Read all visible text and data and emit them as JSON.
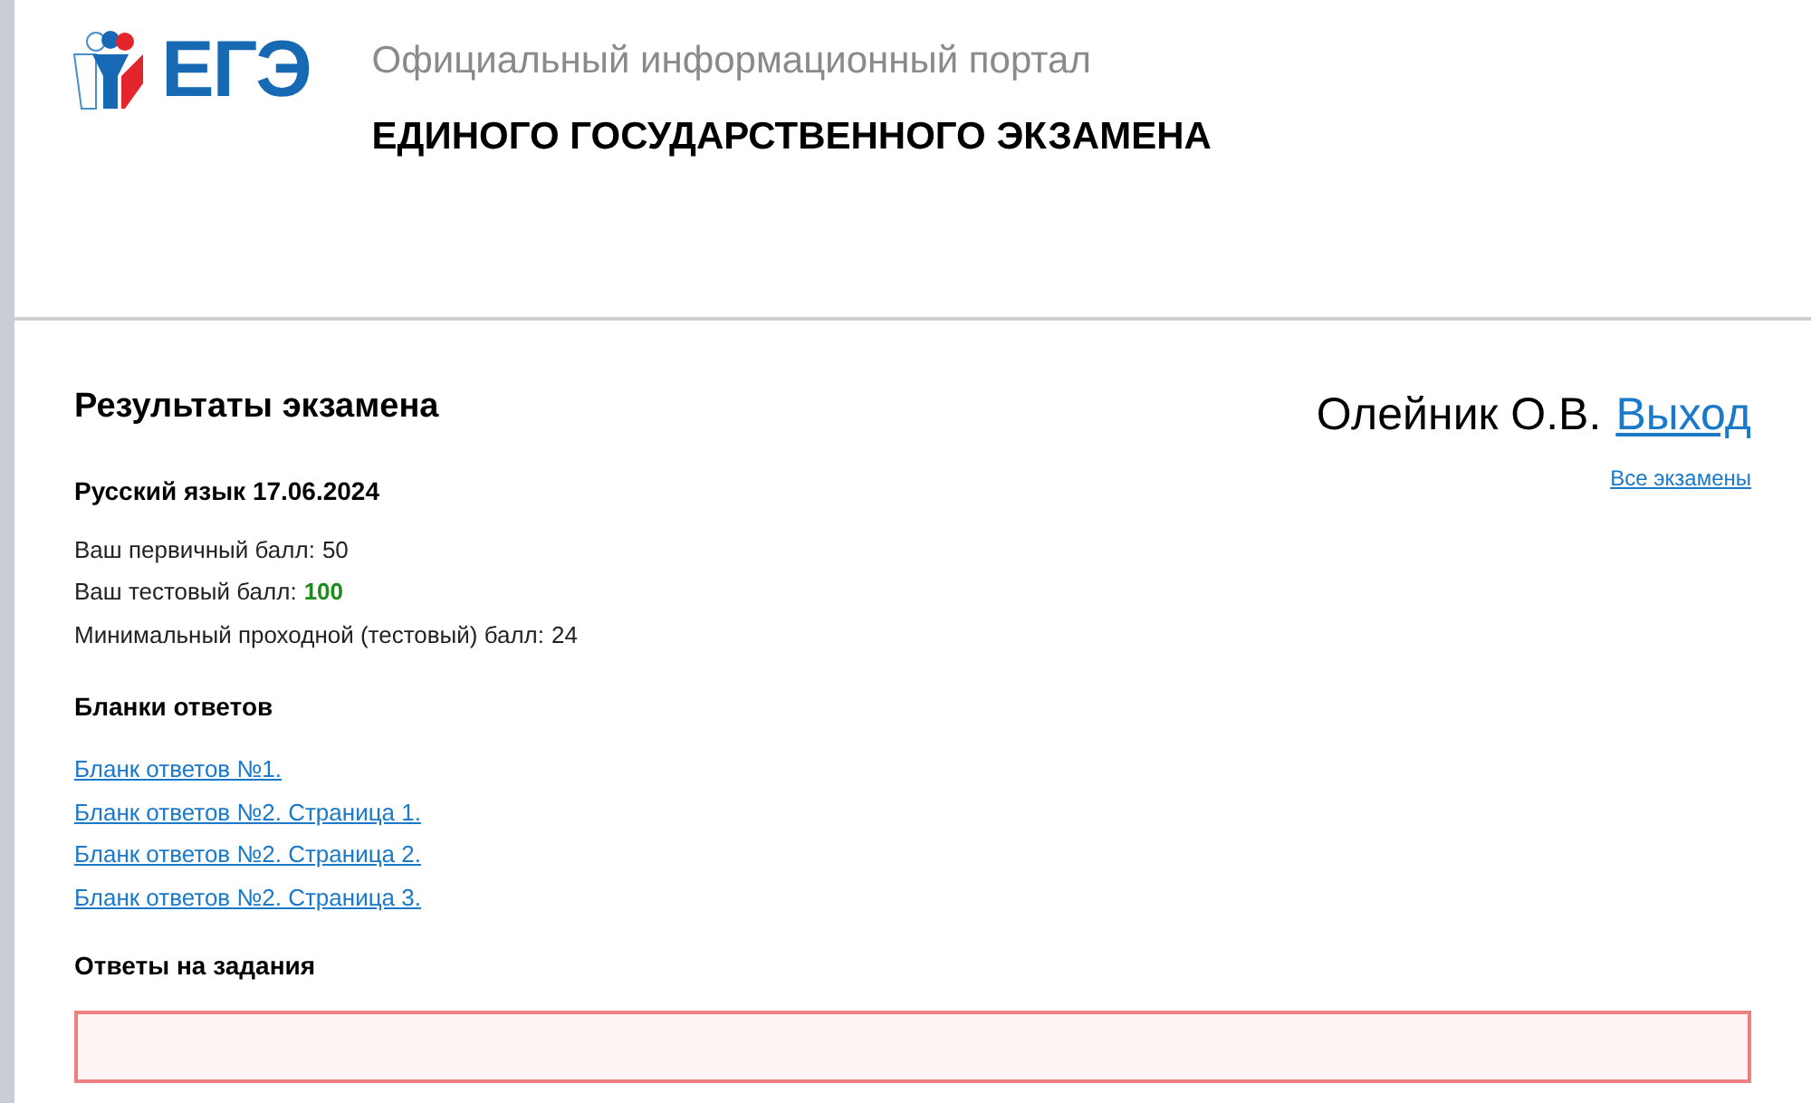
{
  "header": {
    "logo_text": "ЕГЭ",
    "subtitle": "Официальный информационный портал",
    "title": "ЕДИНОГО ГОСУДАРСТВЕННОГО ЭКЗАМЕНА"
  },
  "page_title": "Результаты экзамена",
  "user": {
    "name": "Олейник О.В.",
    "logout": "Выход"
  },
  "all_exams_link": "Все экзамены",
  "exam": {
    "title": "Русский язык 17.06.2024",
    "scores": [
      {
        "label": "Ваш первичный балл:",
        "value": "50",
        "highlighted": false
      },
      {
        "label": "Ваш тестовый балл:",
        "value": "100",
        "highlighted": true
      },
      {
        "label": "Минимальный проходной (тестовый) балл:",
        "value": "24",
        "highlighted": false
      }
    ]
  },
  "answer_forms": {
    "title": "Бланки ответов",
    "links": [
      "Бланк ответов №1.",
      "Бланк ответов №2. Страница 1.",
      "Бланк ответов №2. Страница 2.",
      "Бланк ответов №2. Страница 3."
    ]
  },
  "answers_section": {
    "title": "Ответы на задания"
  }
}
